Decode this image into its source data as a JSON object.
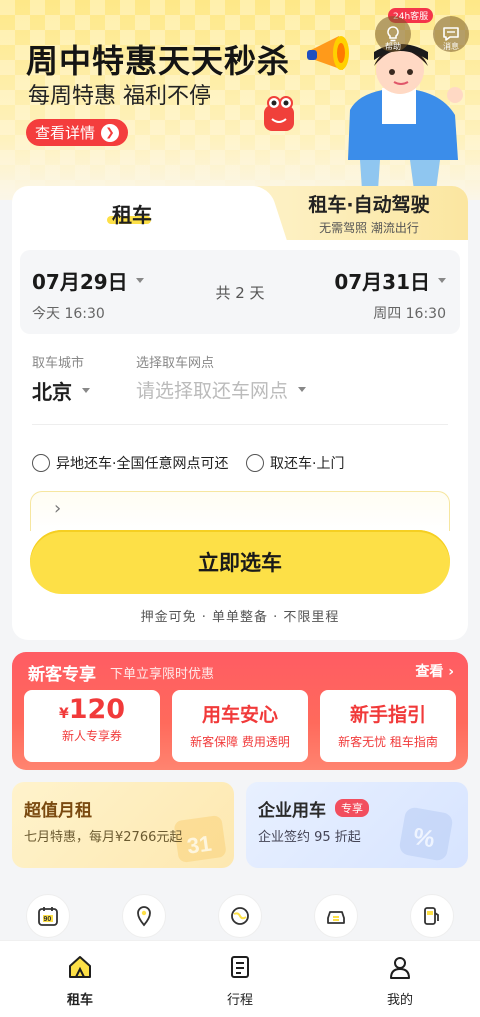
{
  "banner": {
    "title": "周中特惠天天秒杀",
    "subtitle": "每周特惠 福利不停",
    "button_label": "查看详情",
    "service_badge": "24h客服",
    "help_label": "帮助",
    "message_label": "消息"
  },
  "tabs": {
    "active": "租车",
    "inactive_title": "租车·自动驾驶",
    "inactive_subtitle": "无需驾照 潮流出行"
  },
  "dates": {
    "pickup_date": "07月29日",
    "pickup_sub": "今天 16:30",
    "duration": "共 2 天",
    "return_date": "07月31日",
    "return_sub": "周四 16:30"
  },
  "location": {
    "city_label": "取车城市",
    "city_value": "北京",
    "station_label": "选择取车网点",
    "station_placeholder": "请选择取还车网点"
  },
  "options": {
    "option1": "异地还车·全国任意网点可还",
    "option2": "取还车·上门"
  },
  "select_button": "立即选车",
  "features": "押金可免 · 单单整备 · 不限里程",
  "new_customer": {
    "title": "新客专享",
    "subtitle": "下单立享限时优惠",
    "more": "查看",
    "cards": [
      {
        "currency": "¥",
        "main": "120",
        "desc": "新人专享券"
      },
      {
        "main": "用车安心",
        "desc": "新客保障 费用透明"
      },
      {
        "main": "新手指引",
        "desc": "新客无忧 租车指南"
      }
    ]
  },
  "monthly": {
    "title": "超值月租",
    "desc": "七月特惠，每月¥2766元起",
    "deco_text": "31"
  },
  "corporate": {
    "title": "企业用车",
    "badge": "专享",
    "desc": "企业签约 95 折起"
  },
  "shortcuts": [
    "calendar-90-icon",
    "map-pin-icon",
    "globe-icon",
    "car-swap-icon",
    "fuel-icon"
  ],
  "nav": [
    {
      "label": "租车",
      "icon": "home-car-icon",
      "active": true
    },
    {
      "label": "行程",
      "icon": "itinerary-icon",
      "active": false
    },
    {
      "label": "我的",
      "icon": "profile-icon",
      "active": false
    }
  ],
  "colors": {
    "accent_yellow": "#fde047",
    "promo_red": "#ff5c63",
    "banner_red": "#f43d3d"
  }
}
